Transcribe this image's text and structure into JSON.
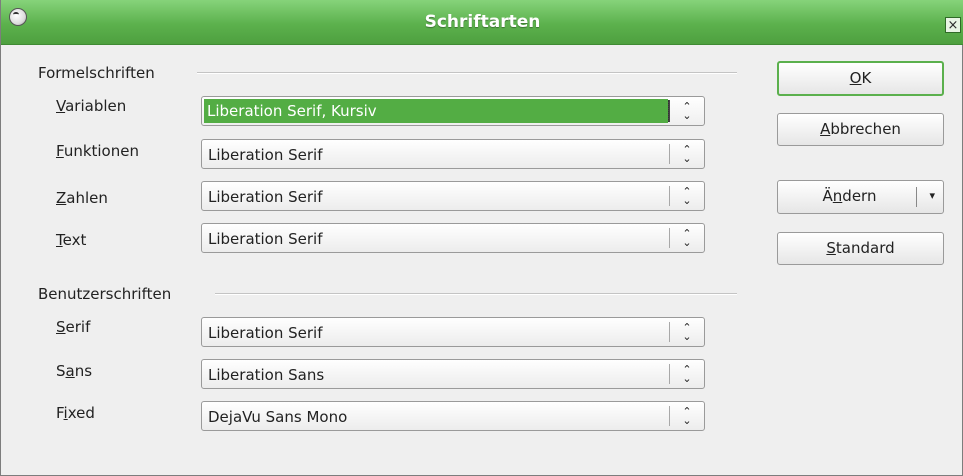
{
  "window": {
    "title": "Schriftarten"
  },
  "sections": {
    "formula_fonts": "Formelschriften",
    "custom_fonts": "Benutzerschriften"
  },
  "rows": {
    "variablen": {
      "label_mnemonic": "V",
      "label_rest": "ariablen",
      "value": "Liberation Serif, Kursiv"
    },
    "funktionen": {
      "label_mnemonic": "F",
      "label_rest": "unktionen",
      "value": "Liberation Serif"
    },
    "zahlen": {
      "label_mnemonic": "Z",
      "label_rest": "ahlen",
      "value": "Liberation Serif"
    },
    "text": {
      "label_mnemonic": "T",
      "label_rest": "ext",
      "value": "Liberation Serif"
    },
    "serif": {
      "label_mnemonic": "S",
      "label_rest": "erif",
      "value": "Liberation Serif"
    },
    "sans": {
      "label_pre": "S",
      "label_mnemonic": "a",
      "label_rest": "ns",
      "value": "Liberation Sans"
    },
    "fixed": {
      "label_pre": "F",
      "label_mnemonic": "i",
      "label_rest": "xed",
      "value": "DejaVu Sans Mono"
    }
  },
  "buttons": {
    "ok": {
      "mnemonic": "O",
      "rest": "K"
    },
    "cancel": {
      "mnemonic": "A",
      "rest": "bbrechen"
    },
    "modify": {
      "pre": "Ä",
      "mnemonic": "n",
      "rest": "dern"
    },
    "standard": {
      "mnemonic": "S",
      "rest": "tandard"
    }
  },
  "icons": {
    "spin": "⌃⌄",
    "dropdown": "▾",
    "close": "×"
  },
  "colors": {
    "accent": "#53ad44",
    "titlebar": "#5cb14d"
  }
}
